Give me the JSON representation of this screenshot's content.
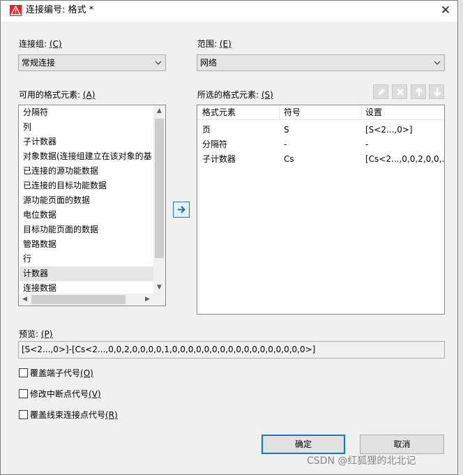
{
  "window": {
    "title": "连接编号: 格式 *",
    "close_glyph": "✕"
  },
  "connection_group": {
    "label": "连接组:",
    "hotkey": "(C)",
    "value": "常规连接"
  },
  "scope": {
    "label": "范围:",
    "hotkey": "(E)",
    "value": "网络"
  },
  "available_elements": {
    "label": "可用的格式元素:",
    "hotkey": "(A)",
    "items": [
      "分隔符",
      "列",
      "子计数器",
      "对象数据(连接组建立在该对象的基",
      "已连接的源功能数据",
      "已连接的目标功能数据",
      "源功能页面的数据",
      "电位数据",
      "目标功能页面的数据",
      "管路数据",
      "行",
      "计数器",
      "连接数据"
    ],
    "selected_index": 11
  },
  "selected_elements": {
    "label": "所选的格式元素:",
    "hotkey": "(S)",
    "columns": [
      "格式元素",
      "符号",
      "设置"
    ],
    "rows": [
      [
        "页",
        "S",
        "[S<2...,0>]"
      ],
      [
        "分隔符",
        "-",
        "-"
      ],
      [
        "子计数器",
        "Cs",
        "[Cs<2...,0,0,2,0,0,..."
      ]
    ]
  },
  "toolbar": {
    "icons": [
      "pencil-icon",
      "delete-x-icon",
      "arrow-up-icon",
      "arrow-down-icon"
    ]
  },
  "add_button": {
    "icon": "arrow-right-icon"
  },
  "preview": {
    "label": "预览:",
    "hotkey": "(P)",
    "value": "[S<2...,0>]-[Cs<2...,0,0,2,0,0,0,0,1,0,0,0,0,0,0,0,0,0,0,0,0,0,0,0,0,0>]"
  },
  "options": [
    {
      "label": "覆盖端子代号",
      "hotkey": "(O)",
      "checked": false
    },
    {
      "label": "修改中断点代号",
      "hotkey": "(V)",
      "checked": false
    },
    {
      "label": "覆盖线束连接点代号",
      "hotkey": "(R)",
      "checked": false
    }
  ],
  "buttons": {
    "ok": "确定",
    "cancel": "取消"
  },
  "watermark": "CSDN @红狐狸的北北记",
  "colors": {
    "accent": "#0078d7",
    "app_icon": "#e32626",
    "selection": "#e5e5e5",
    "combo_bg": "#e5e5e5"
  }
}
